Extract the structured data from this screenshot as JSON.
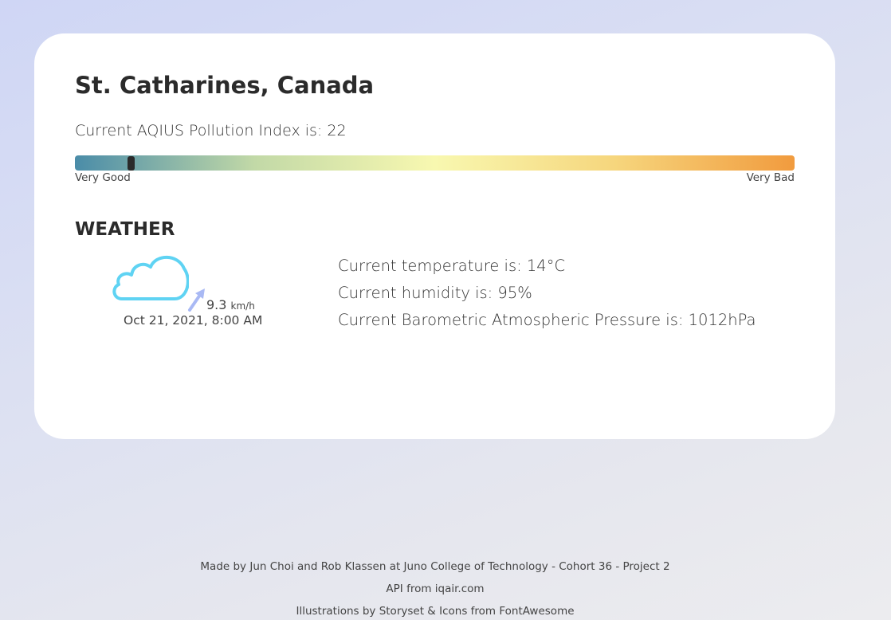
{
  "location": {
    "city_title": "St. Catharines, Canada"
  },
  "air_quality": {
    "text": "Current AQIUS Pollution Index is: 22",
    "aqi_value": 22,
    "scale_fraction": 0.078,
    "scale_low_label": "Very Good",
    "scale_high_label": "Very Bad",
    "gradient_colors": [
      "#4a8ca8",
      "#c2d9a7",
      "#f8f8b0",
      "#f6d67d",
      "#f19b3e"
    ]
  },
  "weather": {
    "title": "WEATHER",
    "icon": "cloud-icon",
    "icon_color": "#5fd3f3",
    "wind_icon": "wind-direction-arrow-icon",
    "wind_icon_color": "#a9b9f4",
    "wind_speed": "9.3",
    "wind_unit": "km/h",
    "timestamp": "Oct 21, 2021, 8:00 AM",
    "temperature_text": "Current temperature is: 14°C",
    "humidity_text": "Current humidity is: 95%",
    "pressure_text": "Current Barometric Atmospheric Pressure is: 1012hPa"
  },
  "footer": {
    "credits": "Made by Jun Choi and Rob Klassen at Juno College of Technology - Cohort 36 - Project 2",
    "api": "API from iqair.com",
    "illustrations": "Illustrations by Storyset & Icons from FontAwesome"
  }
}
